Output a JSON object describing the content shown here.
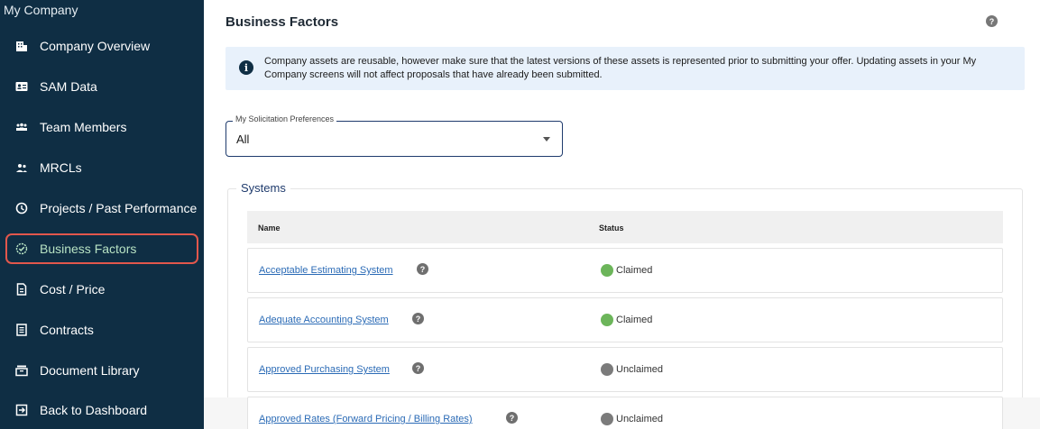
{
  "sidebar": {
    "header": "My Company",
    "items": [
      {
        "label": "Company Overview",
        "icon": "building-icon"
      },
      {
        "label": "SAM Data",
        "icon": "id-card-icon"
      },
      {
        "label": "Team Members",
        "icon": "team-icon"
      },
      {
        "label": "MRCLs",
        "icon": "people-icon"
      },
      {
        "label": "Projects / Past Performance",
        "icon": "history-icon"
      },
      {
        "label": "Business Factors",
        "icon": "badge-check-icon",
        "active": true
      },
      {
        "label": "Cost / Price",
        "icon": "document-dollar-icon"
      },
      {
        "label": "Contracts",
        "icon": "contract-icon"
      },
      {
        "label": "Document Library",
        "icon": "library-icon"
      },
      {
        "label": "Back to Dashboard",
        "icon": "exit-icon"
      }
    ]
  },
  "main": {
    "title": "Business Factors",
    "help_glyph": "?",
    "info_glyph": "i",
    "info_text": "Company assets are reusable, however make sure that the latest versions of these assets is represented prior to submitting your offer. Updating assets in your My Company screens will not affect proposals that have already been submitted.",
    "select": {
      "label": "My Solicitation Preferences",
      "value": "All"
    },
    "systems": {
      "legend": "Systems",
      "columns": {
        "name": "Name",
        "status": "Status"
      },
      "rows": [
        {
          "name": "Acceptable Estimating System",
          "status": "Claimed"
        },
        {
          "name": "Adequate Accounting System",
          "status": "Claimed"
        },
        {
          "name": "Approved Purchasing System",
          "status": "Unclaimed"
        },
        {
          "name": "Approved Rates (Forward Pricing / Billing Rates)",
          "status": "Unclaimed"
        }
      ]
    }
  },
  "colors": {
    "sidebar_bg": "#0f2e44",
    "active_outline": "#e2574c",
    "active_text": "#b7e2c3",
    "claimed": "#6cb55a",
    "unclaimed": "#7b7b7b",
    "link": "#2b6bb6",
    "info_bg": "#e8f1fb"
  }
}
